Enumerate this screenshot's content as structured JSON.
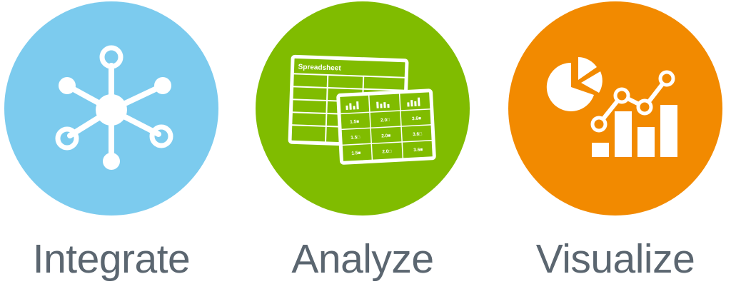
{
  "items": [
    {
      "label": "Integrate",
      "icon": "hub-network-icon",
      "color": "#7ccbee"
    },
    {
      "label": "Analyze",
      "icon": "spreadsheet-icon",
      "color": "#80bc00"
    },
    {
      "label": "Visualize",
      "icon": "charts-icon",
      "color": "#f28a00"
    }
  ],
  "spreadsheet": {
    "title": "Spreadsheet",
    "cells": [
      "1.5■",
      "2.0□",
      "3.6■",
      "1.5□",
      "2.0■",
      "3.6□",
      "1.5■",
      "2.0□",
      "3.6■"
    ]
  }
}
